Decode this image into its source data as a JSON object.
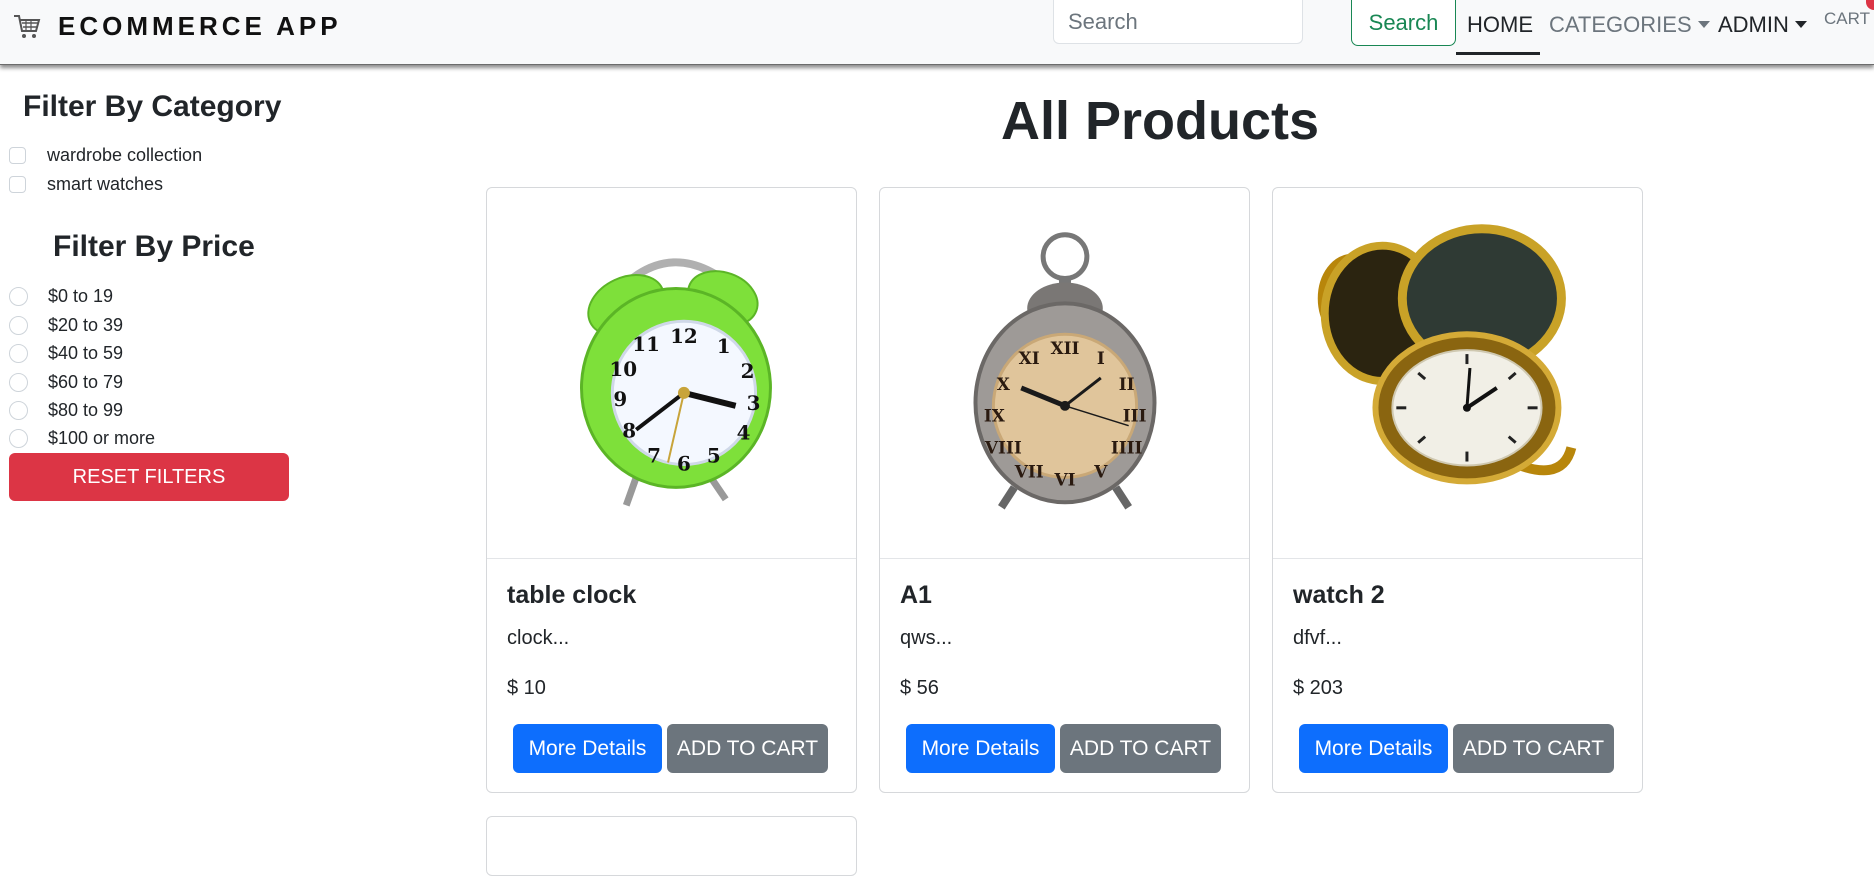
{
  "navbar": {
    "brand": "ECOMMERCE APP",
    "search_placeholder": "Search",
    "search_button": "Search",
    "links": {
      "home": "HOME",
      "categories": "CATEGORIES",
      "admin": "ADMIN",
      "cart": "CART"
    }
  },
  "sidebar": {
    "category_title": "Filter By Category",
    "categories": [
      "wardrobe collection",
      "smart watches"
    ],
    "price_title": "Filter By Price",
    "prices": [
      "$0 to 19",
      "$20 to 39",
      "$40 to 59",
      "$60 to 79",
      "$80 to 99",
      "$100 or more"
    ],
    "reset_label": "RESET FILTERS"
  },
  "main": {
    "title": "All Products",
    "products": [
      {
        "name": "table clock",
        "desc": "clock...",
        "price": "$ 10",
        "details_label": "More Details",
        "cart_label": "ADD TO CART",
        "image": "green-alarm-clock"
      },
      {
        "name": "A1",
        "desc": "qws...",
        "price": "$ 56",
        "details_label": "More Details",
        "cart_label": "ADD TO CART",
        "image": "vintage-alarm-clock"
      },
      {
        "name": "watch 2",
        "desc": "dfvf...",
        "price": "$ 203",
        "details_label": "More Details",
        "cart_label": "ADD TO CART",
        "image": "gold-pocket-watch"
      }
    ]
  },
  "colors": {
    "primary": "#0d6efd",
    "secondary": "#6c757d",
    "danger": "#dc3545",
    "success": "#198754",
    "alarm_green": "#7ee03a",
    "gold": "#b8860b"
  }
}
